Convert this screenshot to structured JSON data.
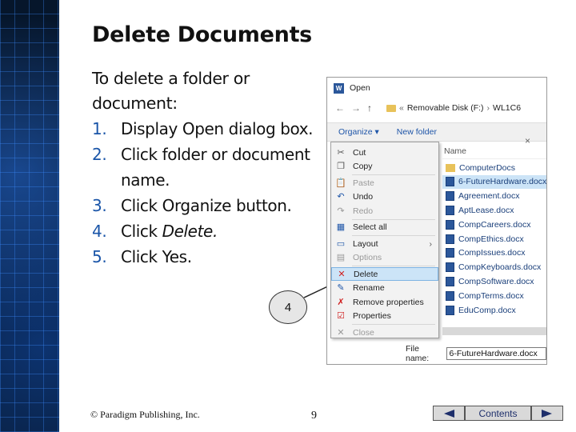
{
  "slide": {
    "title": "Delete Documents",
    "intro": "To delete a folder or document:",
    "steps": [
      {
        "num": "1.",
        "text": "Display Open dialog box."
      },
      {
        "num": "2.",
        "text": "Click folder or document name."
      },
      {
        "num": "3.",
        "text": "Click Organize button."
      },
      {
        "num": "4.",
        "pre": "Click ",
        "em": "Delete."
      },
      {
        "num": "5.",
        "text": "Click Yes."
      }
    ],
    "callout": "4"
  },
  "dialog": {
    "title": "Open",
    "word_icon": "W",
    "nav": {
      "back": "←",
      "forward": "→",
      "up": "↑"
    },
    "path_prefix": "«",
    "path_drive": "Removable Disk (F:)",
    "path_sep": "›",
    "path_folder": "WL1C6",
    "toolbar": {
      "organize": "Organize ▾",
      "new_folder": "New folder"
    },
    "column_name": "Name",
    "close_glyph": "×",
    "files": [
      {
        "name": "ComputerDocs",
        "type": "folder",
        "selected": false
      },
      {
        "name": "6-FutureHardware.docx",
        "type": "doc",
        "selected": true
      },
      {
        "name": "Agreement.docx",
        "type": "doc",
        "selected": false
      },
      {
        "name": "AptLease.docx",
        "type": "doc",
        "selected": false
      },
      {
        "name": "CompCareers.docx",
        "type": "doc",
        "selected": false
      },
      {
        "name": "CompEthics.docx",
        "type": "doc",
        "selected": false
      },
      {
        "name": "CompIssues.docx",
        "type": "doc",
        "selected": false
      },
      {
        "name": "CompKeyboards.docx",
        "type": "doc",
        "selected": false
      },
      {
        "name": "CompSoftware.docx",
        "type": "doc",
        "selected": false
      },
      {
        "name": "CompTerms.docx",
        "type": "doc",
        "selected": false
      },
      {
        "name": "EduComp.docx",
        "type": "doc",
        "selected": false
      }
    ],
    "menu": [
      {
        "label": "Cut",
        "icon": "scissors-icon",
        "glyph": "✂",
        "color": "#555555"
      },
      {
        "label": "Copy",
        "icon": "copy-icon",
        "glyph": "❐",
        "color": "#555555"
      },
      {
        "label": "Paste",
        "icon": "paste-icon",
        "glyph": "📋",
        "color": "#999999",
        "disabled": true
      },
      {
        "label": "Undo",
        "icon": "undo-icon",
        "glyph": "↶",
        "color": "#1e55a8"
      },
      {
        "label": "Redo",
        "icon": "redo-icon",
        "glyph": "↷",
        "color": "#999999",
        "disabled": true
      },
      {
        "label": "Select all",
        "icon": "select-all-icon",
        "glyph": "▦",
        "color": "#1e55a8"
      },
      {
        "label": "Layout",
        "icon": "layout-icon",
        "glyph": "▭",
        "color": "#1e55a8",
        "submenu": true
      },
      {
        "label": "Options",
        "icon": "options-icon",
        "glyph": "▤",
        "color": "#999999",
        "disabled": true
      },
      {
        "label": "Delete",
        "icon": "delete-x-icon",
        "glyph": "✕",
        "color": "#d02020",
        "highlight": true
      },
      {
        "label": "Rename",
        "icon": "rename-icon",
        "glyph": "✎",
        "color": "#1e55a8"
      },
      {
        "label": "Remove properties",
        "icon": "remove-properties-icon",
        "glyph": "✗",
        "color": "#d02020"
      },
      {
        "label": "Properties",
        "icon": "properties-icon",
        "glyph": "☑",
        "color": "#d02020"
      },
      {
        "label": "Close",
        "icon": "close-icon",
        "glyph": "✕",
        "color": "#999999",
        "disabled": true
      }
    ],
    "file_name_label": "File name:",
    "file_name_value": "6-FutureHardware.docx"
  },
  "footer": {
    "copyright": "© Paradigm Publishing, Inc.",
    "page": "9",
    "contents": "Contents"
  }
}
